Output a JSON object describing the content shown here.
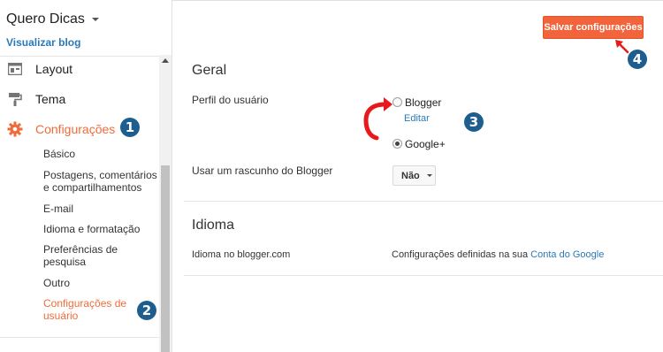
{
  "header": {
    "blog_title": "Quero Dicas",
    "view_blog": "Visualizar blog",
    "save_button": "Salvar configurações"
  },
  "sidebar": {
    "items": [
      {
        "label": "Layout",
        "icon": "layout-icon"
      },
      {
        "label": "Tema",
        "icon": "paint-roller-icon"
      },
      {
        "label": "Configurações",
        "icon": "gear-icon",
        "active": true
      }
    ],
    "subitems": [
      {
        "label": "Básico"
      },
      {
        "label": "Postagens, comentários e compartilhamentos"
      },
      {
        "label": "E-mail"
      },
      {
        "label": "Idioma e formatação"
      },
      {
        "label": "Preferências de pesquisa"
      },
      {
        "label": "Outro"
      },
      {
        "label": "Configurações de usuário",
        "active": true
      }
    ]
  },
  "main": {
    "general": {
      "title": "Geral",
      "profile_label": "Perfil do usuário",
      "options": [
        {
          "label": "Blogger",
          "checked": false
        },
        {
          "label": "Google+",
          "checked": true
        }
      ],
      "edit_link": "Editar",
      "draft_label": "Usar um rascunho do Blogger",
      "draft_value": "Não"
    },
    "language": {
      "title": "Idioma",
      "row_label": "Idioma no blogger.com",
      "row_text": "Configurações definidas na sua",
      "row_link": "Conta do Google"
    }
  },
  "annotations": [
    "1",
    "2",
    "3",
    "4"
  ],
  "colors": {
    "accent": "#ef6c3a",
    "save_button": "#f2643b",
    "link": "#2a7ab8",
    "badge": "#1e5e8f",
    "arrow": "#e8191a"
  }
}
